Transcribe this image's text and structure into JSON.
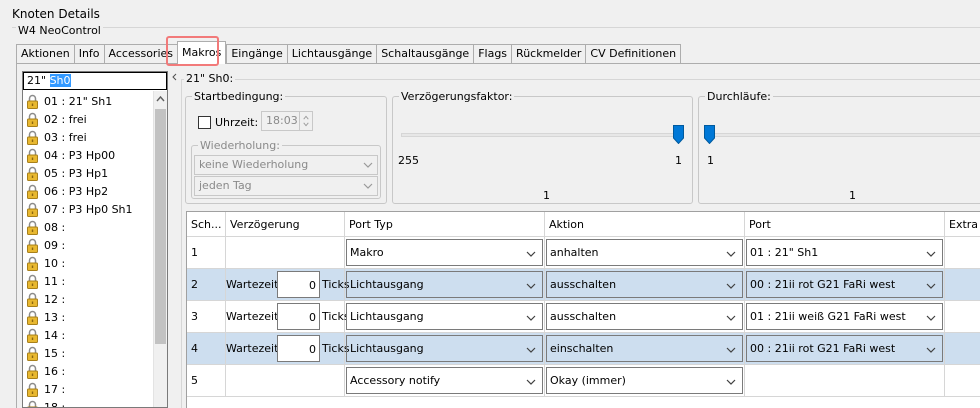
{
  "window": {
    "title": "Knoten Details",
    "group_label": "W4 NeoControl"
  },
  "tabs": [
    "Aktionen",
    "Info",
    "Accessories",
    "Makros",
    "Eingänge",
    "Lichtausgänge",
    "Schaltausgänge",
    "Flags",
    "Rückmelder",
    "CV Definitionen"
  ],
  "active_tab": "Makros",
  "macro_list": {
    "edit_prefix": "21\" ",
    "edit_selected": "Sh0",
    "items": [
      "01 : 21\" Sh1",
      "02 : frei",
      "03 : frei",
      "04 : P3 Hp00",
      "05 : P3 Hp1",
      "06 : P3 Hp2",
      "07 : P3 Hp0 Sh1",
      "08 :",
      "09 :",
      "10 :",
      "11 :",
      "12 :",
      "13 :",
      "14 :",
      "15 :",
      "16 :",
      "17 :",
      "18 :"
    ]
  },
  "macro_group_label": "21\" Sh0:",
  "start": {
    "label": "Startbedingung:",
    "time_label": "Uhrzeit:",
    "time_value": "18:03",
    "repeat_label": "Wiederholung:",
    "repeat_value": "keine Wiederholung",
    "day_value": "jeden Tag"
  },
  "delay_factor": {
    "label": "Verzögerungsfaktor:",
    "min_label": "255",
    "max_label": "1",
    "value_label": "1",
    "value": 1
  },
  "runs": {
    "label": "Durchläufe:",
    "min_label": "1",
    "value_label": "1",
    "value": 1
  },
  "table": {
    "headers": [
      "Sch...",
      "Verzögerung",
      "Port Typ",
      "Aktion",
      "Port",
      "Extra"
    ],
    "wait_label": "Wartezeit:",
    "ticks_label": "Ticks",
    "rows": [
      {
        "step": "1",
        "has_delay": false,
        "ticks": "",
        "port_type": "Makro",
        "action": "anhalten",
        "port": "01 : 21\" Sh1"
      },
      {
        "step": "2",
        "has_delay": true,
        "ticks": "0",
        "port_type": "Lichtausgang",
        "action": "ausschalten",
        "port": "00 : 21ii rot G21 FaRi west"
      },
      {
        "step": "3",
        "has_delay": true,
        "ticks": "0",
        "port_type": "Lichtausgang",
        "action": "ausschalten",
        "port": "01 : 21ii weiß G21 FaRi west"
      },
      {
        "step": "4",
        "has_delay": true,
        "ticks": "0",
        "port_type": "Lichtausgang",
        "action": "einschalten",
        "port": "00 : 21ii rot G21 FaRi west"
      },
      {
        "step": "5",
        "has_delay": false,
        "ticks": "",
        "port_type": "Accessory notify",
        "action": "Okay (immer)",
        "port": ""
      }
    ]
  },
  "colors": {
    "selected_row": "#cddeef",
    "selection": "#3399ff",
    "slider_thumb": "#0078d7",
    "tab_highlight": "#f27a7a"
  }
}
